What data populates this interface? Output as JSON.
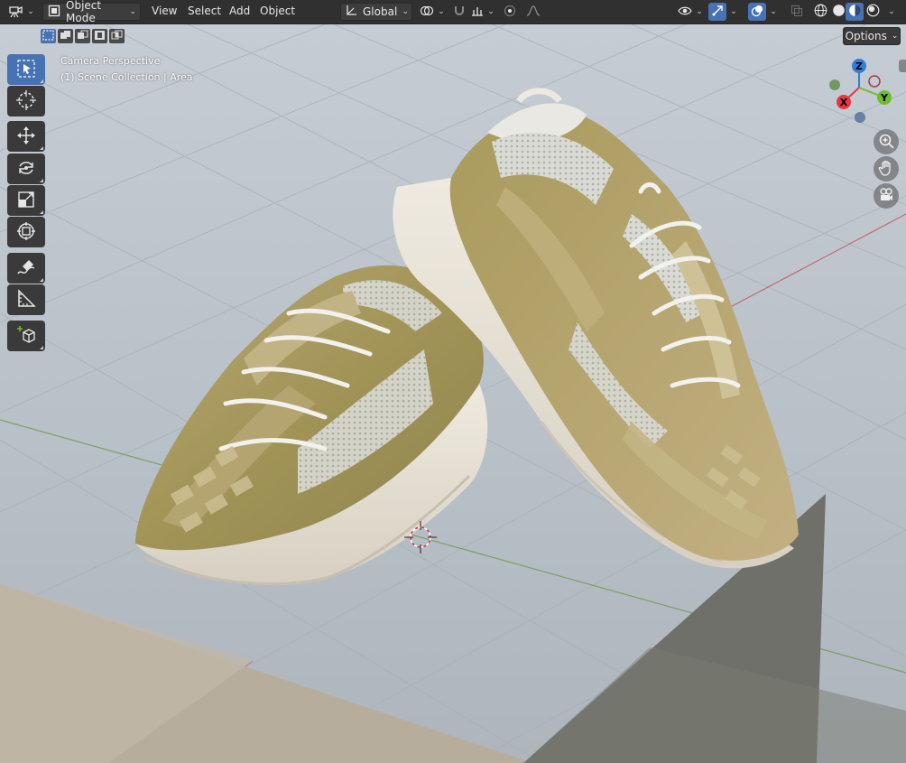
{
  "header": {
    "editor_type_icon": "camera-tripod-icon",
    "mode": "Object Mode",
    "menus": [
      "View",
      "Select",
      "Add",
      "Object"
    ],
    "transform_orientation": "Global"
  },
  "tool_header": {
    "options_label": "Options"
  },
  "viewport": {
    "perspective_label": "Camera Perspective",
    "collection_label": "(1) Scene Collection | Area"
  },
  "toolbar": {
    "tools": [
      "select-box",
      "cursor",
      "move",
      "rotate",
      "scale",
      "transform",
      "annotate",
      "measure",
      "add-cube"
    ],
    "active_tool": "select-box"
  },
  "gizmo": {
    "axis_x": "X",
    "axis_y": "Y",
    "axis_z": "Z"
  },
  "colors": {
    "header_bg": "#303030",
    "active_blue": "#4772b3",
    "axis_x": "#e8363f",
    "axis_y": "#6fbd2b",
    "axis_z": "#2e7fd6",
    "viewport_bg": "#b9c0c8"
  }
}
